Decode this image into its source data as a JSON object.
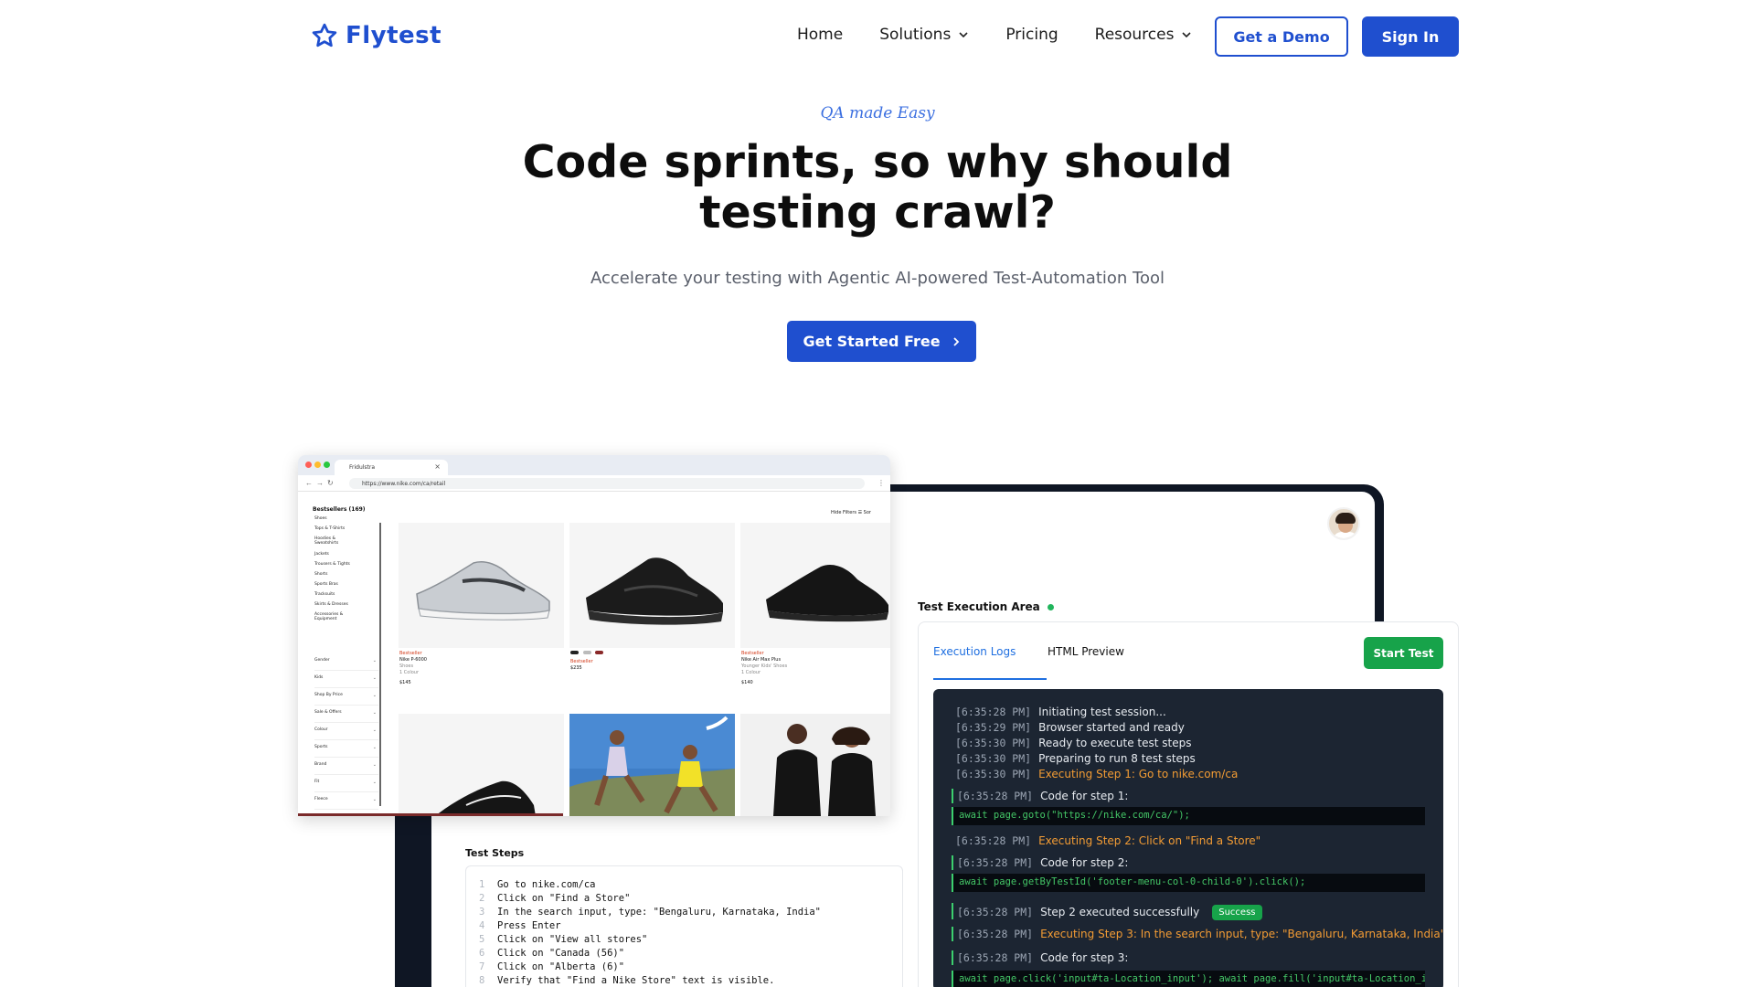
{
  "brand": {
    "name": "Flytest",
    "accent": "#1f4fcf"
  },
  "nav": {
    "links": [
      {
        "label": "Home",
        "has_dropdown": false
      },
      {
        "label": "Solutions",
        "has_dropdown": true
      },
      {
        "label": "Pricing",
        "has_dropdown": false
      },
      {
        "label": "Resources",
        "has_dropdown": true
      }
    ],
    "demo_label": "Get a Demo",
    "signin_label": "Sign In"
  },
  "hero": {
    "eyebrow": "QA made Easy",
    "headline": "Code sprints, so why should testing crawl?",
    "subline": "Accelerate your testing with Agentic AI-powered Test-Automation Tool",
    "cta_label": "Get Started Free"
  },
  "browser": {
    "tab_title": "Fridulstra",
    "url": "https://www.nike.com/ca/retail",
    "sidebar_title": "Bestsellers (169)",
    "categories": [
      "Shoes",
      "Tops & T-Shirts",
      "Hoodies & Sweatshirts",
      "Jackets",
      "Trousers & Tights",
      "Shorts",
      "Sports Bras",
      "Tracksuits",
      "Skirts & Dresses",
      "Accessories & Equipment"
    ],
    "filters": [
      "Gender",
      "Kids",
      "Shop By Price",
      "Sale & Offers",
      "Colour",
      "Sports",
      "Brand",
      "Fit",
      "Fleece"
    ],
    "hide_filters": "Hide Filters",
    "sort_label": "Sor",
    "products": [
      {
        "badge": "Bestseller",
        "name": "Nike P-6000",
        "category": "Shoes",
        "colours": "1 Colour",
        "price": "$145"
      },
      {
        "badge": "Bestseller",
        "name": "",
        "category": "",
        "colours": "",
        "price": "$235"
      },
      {
        "badge": "Bestseller",
        "name": "Nike Air Max Plus",
        "category": "Younger Kids' Shoes",
        "colours": "1 Colour",
        "price": "$140"
      }
    ]
  },
  "execution": {
    "area_title": "Test Execution Area",
    "tabs": [
      "Execution Logs",
      "HTML Preview"
    ],
    "start_label": "Start Test",
    "status_color": "#17a34a",
    "logs": [
      {
        "ts": "[6:35:28 PM]",
        "msg": "Initiating test session..."
      },
      {
        "ts": "[6:35:29 PM]",
        "msg": "Browser started and ready"
      },
      {
        "ts": "[6:35:30 PM]",
        "msg": "Ready to execute test steps"
      },
      {
        "ts": "[6:35:30 PM]",
        "msg": "Preparing to run 8 test steps"
      },
      {
        "ts": "[6:35:30 PM]",
        "msg": "Executing Step 1:  Go to nike.com/ca"
      },
      {
        "ts": "[6:35:28 PM]",
        "msg": "Code for step 1:"
      },
      {
        "code": "await page.goto(\"https://nike.com/ca/\");"
      },
      {
        "ts": "[6:35:28 PM]",
        "msg": "Executing Step 2:  Click on \"Find a Store\""
      },
      {
        "ts": "[6:35:28 PM]",
        "msg": "Code for step 2:"
      },
      {
        "code": "await page.getByTestId('footer-menu-col-0-child-0').click();"
      },
      {
        "ts": "[6:35:28 PM]",
        "msg": "Step 2 executed successfully",
        "badge": "Success"
      },
      {
        "ts": "[6:35:28 PM]",
        "msg": "Executing Step 3: In the search input, type: \"Bengaluru, Karnataka, India\""
      },
      {
        "ts": "[6:35:28 PM]",
        "msg": "Code for step 3:"
      },
      {
        "code": "await page.click('input#ta-Location_input'); await page.fill('input#ta-Location_input', 'Bengaluru, Karnataka, India');"
      }
    ]
  },
  "test_steps": {
    "title": "Test Steps",
    "steps": [
      "Go to nike.com/ca",
      "Click on \"Find a Store\"",
      "In the search input, type: \"Bengaluru, Karnataka, India\"",
      "Press Enter",
      "Click on \"View all stores\"",
      "Click on \"Canada (56)\"",
      "Click on \"Alberta (6)\"",
      "Verify that \"Find a Nike Store\" text is visible."
    ]
  }
}
